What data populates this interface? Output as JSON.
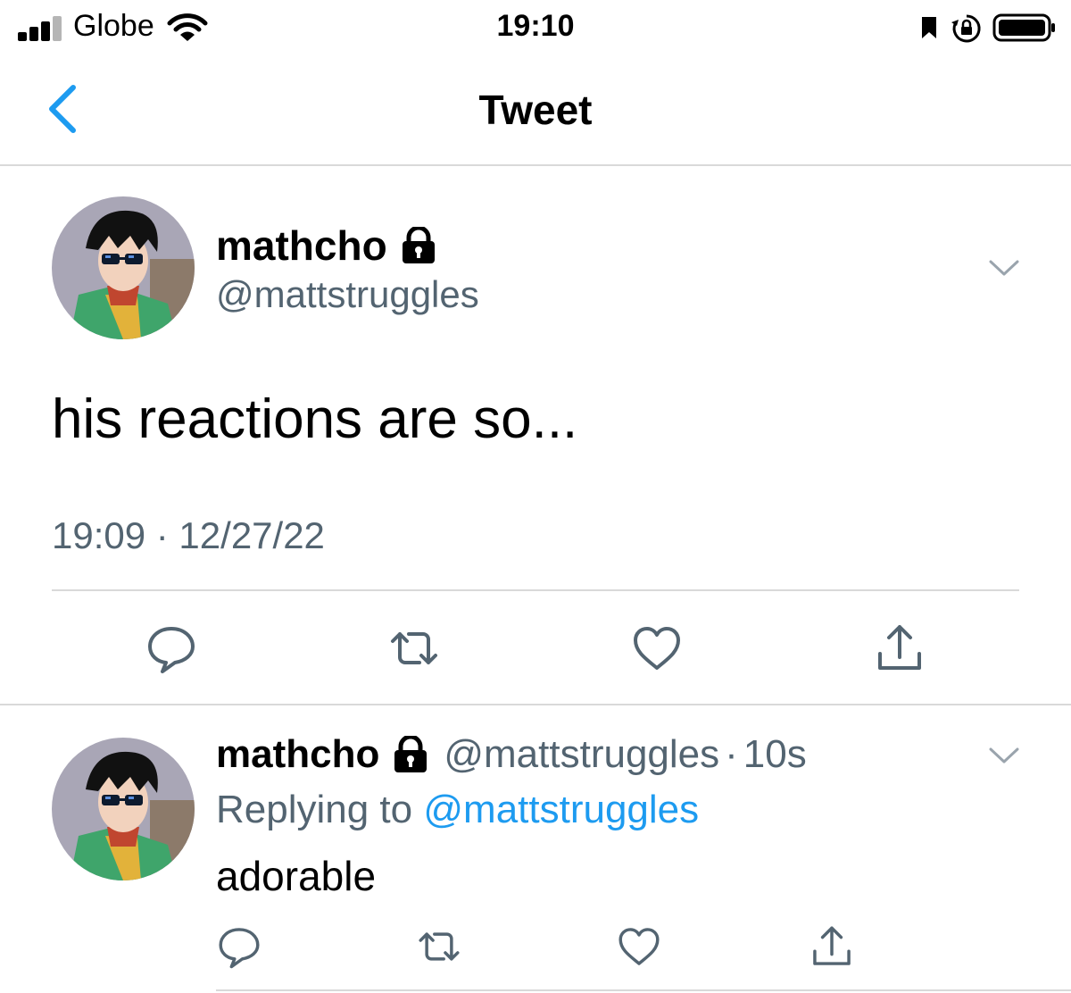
{
  "status_bar": {
    "carrier": "Globe",
    "time": "19:10",
    "icons": [
      "signal-icon",
      "wifi-icon",
      "bookmark-icon",
      "orientation-lock-icon",
      "battery-icon"
    ]
  },
  "nav": {
    "title": "Tweet",
    "back_icon": "chevron-left-icon",
    "accent_color": "#1d9bf0"
  },
  "main_tweet": {
    "display_name": "mathcho",
    "protected_icon": "lock-icon",
    "handle": "@mattstruggles",
    "text": "his reactions are so...",
    "timestamp": "19:09 · 12/27/22",
    "menu_icon": "chevron-down-icon",
    "actions": [
      "reply-icon",
      "retweet-icon",
      "like-icon",
      "share-icon"
    ]
  },
  "reply": {
    "display_name": "mathcho",
    "handle": "@mattstruggles",
    "dot": "·",
    "age": "10s",
    "replying_prefix": "Replying to",
    "replying_to": "@mattstruggles",
    "text": "adorable",
    "menu_icon": "chevron-down-icon",
    "actions": [
      "reply-icon",
      "retweet-icon",
      "like-icon",
      "share-icon"
    ]
  },
  "colors": {
    "text": "#0f1419",
    "secondary": "#536471",
    "link": "#1d9bf0",
    "divider": "#d9d9d9"
  }
}
